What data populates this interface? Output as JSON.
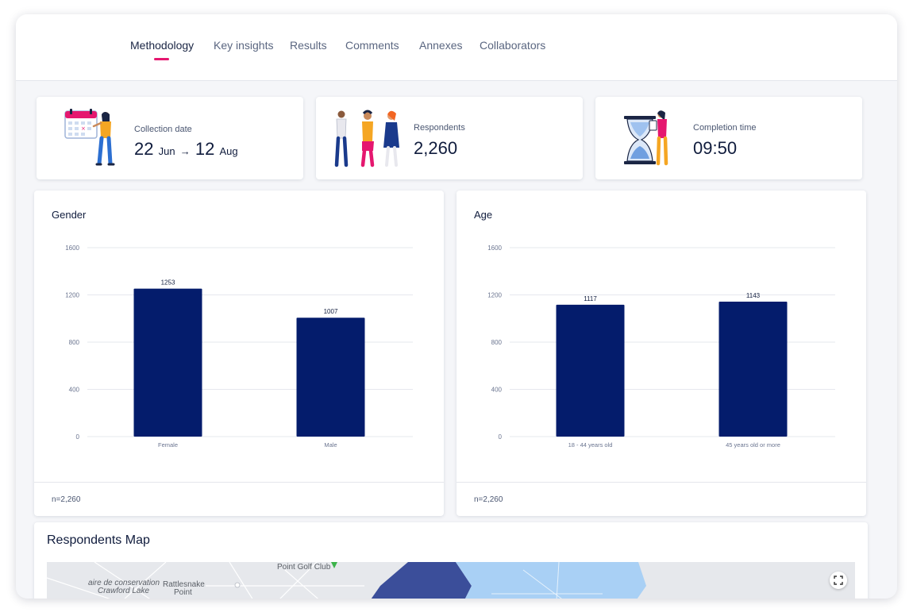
{
  "tabs": [
    {
      "label": "Methodology",
      "active": true
    },
    {
      "label": "Key insights"
    },
    {
      "label": "Results"
    },
    {
      "label": "Comments"
    },
    {
      "label": "Annexes"
    },
    {
      "label": "Collaborators"
    }
  ],
  "stats": {
    "collection": {
      "label": "Collection date",
      "start_day": "22",
      "start_month": "Jun",
      "arrow": "→",
      "end_day": "12",
      "end_month": "Aug",
      "icon": "calendar-illustration"
    },
    "respondents": {
      "label": "Respondents",
      "value": "2,260",
      "icon": "people-illustration"
    },
    "completion": {
      "label": "Completion time",
      "value": "09:50",
      "icon": "hourglass-illustration"
    }
  },
  "charts": {
    "gender": {
      "title": "Gender",
      "n_label": "n=2,260"
    },
    "age": {
      "title": "Age",
      "n_label": "n=2,260"
    }
  },
  "chart_data": [
    {
      "type": "bar",
      "title": "Gender",
      "categories": [
        "Female",
        "Male"
      ],
      "values": [
        1253,
        1007
      ],
      "ylim": [
        0,
        1600
      ],
      "yticks": [
        0,
        400,
        800,
        1200,
        1600
      ],
      "grid": true,
      "bar_color": "#041c6c"
    },
    {
      "type": "bar",
      "title": "Age",
      "categories": [
        "18 - 44 years old",
        "45 years old or more"
      ],
      "values": [
        1117,
        1143
      ],
      "ylim": [
        0,
        1600
      ],
      "yticks": [
        0,
        400,
        800,
        1200,
        1600
      ],
      "grid": true,
      "bar_color": "#041c6c"
    }
  ],
  "map": {
    "title": "Respondents Map",
    "labels": {
      "golf": "Point Golf Club",
      "conservation_1": "aire de conservation",
      "conservation_2": "Crawford Lake",
      "rattlesnake_1": "Rattlesnake",
      "rattlesnake_2": "Point"
    },
    "colors": {
      "dark_region": "#3b4e9a",
      "light_region": "#a9d0f5",
      "base": "#e6e8ec",
      "golf_marker": "#3cb34a"
    }
  },
  "colors": {
    "accent": "#e5176f",
    "navy": "#041c6c"
  }
}
